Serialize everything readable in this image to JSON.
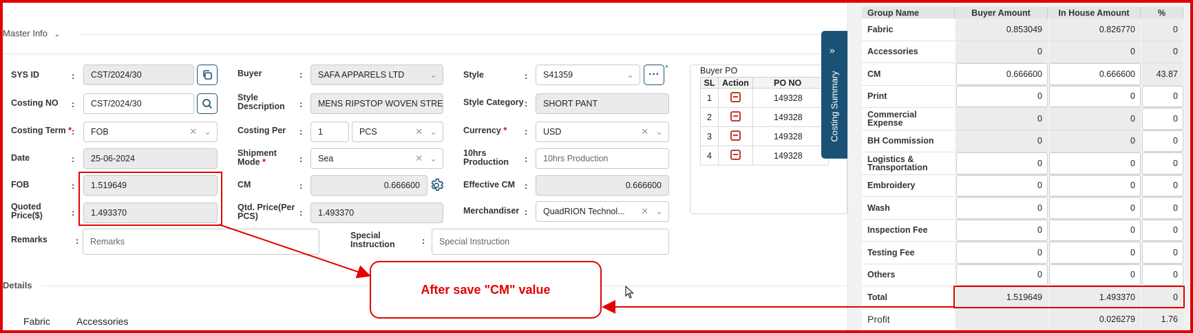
{
  "master_info": {
    "title": "Master Info"
  },
  "details": {
    "title": "Details"
  },
  "fields": {
    "sys_id": {
      "label": "SYS ID",
      "value": "CST/2024/30"
    },
    "costing_no": {
      "label": "Costing NO",
      "value": "CST/2024/30"
    },
    "costing_term": {
      "label": "Costing Term",
      "value": "FOB"
    },
    "date": {
      "label": "Date",
      "value": "25-06-2024"
    },
    "fob": {
      "label": "FOB",
      "value": "1.519649"
    },
    "quoted_price": {
      "label_1": "Quoted",
      "label_2": "Price($)",
      "value": "1.493370"
    },
    "remarks": {
      "label": "Remarks",
      "placeholder": "Remarks"
    },
    "buyer": {
      "label": "Buyer",
      "value": "SAFA APPARELS LTD"
    },
    "style_desc": {
      "label_1": "Style",
      "label_2": "Description",
      "value": "MENS RIPSTOP WOVEN STRETC"
    },
    "costing_per": {
      "label": "Costing Per",
      "qty": "1",
      "unit": "PCS"
    },
    "shipment_mode": {
      "label_1": "Shipment",
      "label_2": "Mode",
      "value": "Sea"
    },
    "cm": {
      "label": "CM",
      "value": "0.666600"
    },
    "qtd_price": {
      "label_1": "Qtd. Price(Per",
      "label_2": "PCS)",
      "value": "1.493370"
    },
    "special_instruction": {
      "label_1": "Special",
      "label_2": "Instruction",
      "placeholder": "Special Instruction"
    },
    "style": {
      "label": "Style",
      "value": "S41359"
    },
    "style_category": {
      "label": "Style Category",
      "value": "SHORT PANT"
    },
    "currency": {
      "label": "Currency",
      "value": "USD"
    },
    "production_10hrs": {
      "label_1": "10hrs",
      "label_2": "Production",
      "placeholder": "10hrs Production"
    },
    "effective_cm": {
      "label": "Effective CM",
      "value": "0.666600"
    },
    "merchandiser": {
      "label": "Merchandiser",
      "value": "QuadRION Technol..."
    }
  },
  "buyer_po": {
    "title": "Buyer PO",
    "headers": [
      "SL",
      "Action",
      "PO NO"
    ],
    "rows": [
      {
        "sl": "1",
        "po": "149328"
      },
      {
        "sl": "2",
        "po": "149328"
      },
      {
        "sl": "3",
        "po": "149328"
      },
      {
        "sl": "4",
        "po": "149328"
      }
    ]
  },
  "costing_summary": {
    "tab_label": "Costing Summary",
    "headers": [
      "Group Name",
      "Buyer Amount",
      "In House Amount",
      "%"
    ],
    "rows": [
      {
        "name": "Fabric",
        "buyer": "0.853049",
        "inhouse": "0.826770",
        "pct": "0"
      },
      {
        "name": "Accessories",
        "buyer": "0",
        "inhouse": "0",
        "pct": "0"
      },
      {
        "name": "CM",
        "buyer": "0.666600",
        "inhouse": "0.666600",
        "pct": "43.87"
      },
      {
        "name": "Print",
        "buyer": "0",
        "inhouse": "0",
        "pct": "0"
      },
      {
        "name": "Commercial Expense",
        "buyer": "0",
        "inhouse": "0",
        "pct": "0"
      },
      {
        "name": "BH Commission",
        "buyer": "0",
        "inhouse": "0",
        "pct": "0"
      },
      {
        "name": "Logistics & Transportation",
        "buyer": "0",
        "inhouse": "0",
        "pct": "0"
      },
      {
        "name": "Embroidery",
        "buyer": "0",
        "inhouse": "0",
        "pct": "0"
      },
      {
        "name": "Wash",
        "buyer": "0",
        "inhouse": "0",
        "pct": "0"
      },
      {
        "name": "Inspection Fee",
        "buyer": "0",
        "inhouse": "0",
        "pct": "0"
      },
      {
        "name": "Testing Fee",
        "buyer": "0",
        "inhouse": "0",
        "pct": "0"
      },
      {
        "name": "Others",
        "buyer": "0",
        "inhouse": "0",
        "pct": "0"
      },
      {
        "name": "Total",
        "buyer": "1.519649",
        "inhouse": "1.493370",
        "pct": "0"
      },
      {
        "name": "Profit",
        "buyer": "",
        "inhouse": "0.026279",
        "pct": "1.76"
      }
    ]
  },
  "callout": {
    "text": "After save \"CM\" value"
  },
  "detail_tabs": [
    "Fabric",
    "Accessories"
  ],
  "colors": {
    "accent": "#1a5276",
    "annotation": "#e20000"
  }
}
